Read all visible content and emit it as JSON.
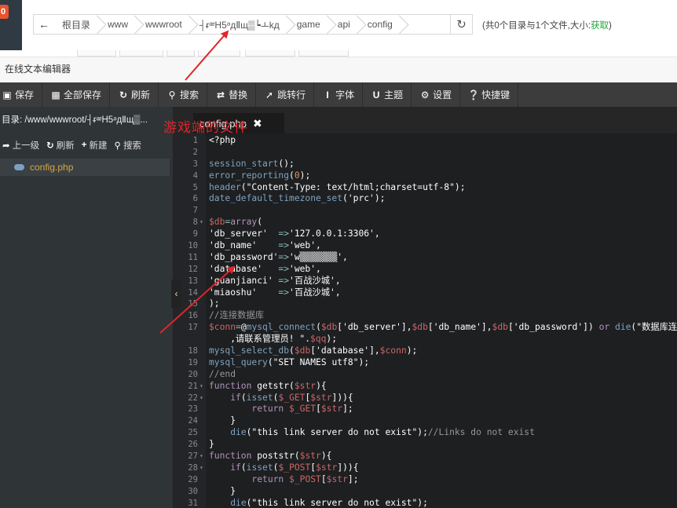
{
  "topbar": {
    "badge": "0",
    "back_icon": "arrow-left-icon",
    "breadcrumbs": [
      "根目录",
      "www",
      "wwwroot",
      "┤ᵲᵆH5ᵊдⅡщ▒┕ㅗkд",
      "game",
      "api",
      "config"
    ],
    "refresh_icon": "refresh-icon",
    "file_info": "(共0个目录与1个文件,大小:",
    "file_info_link": "获取",
    "file_info_end": ")"
  },
  "modal": {
    "title": "在线文本编辑器"
  },
  "toolbar": {
    "buttons": [
      {
        "label": "保存",
        "icon": "save-icon"
      },
      {
        "label": "全部保存",
        "icon": "save-all-icon"
      },
      {
        "label": "刷新",
        "icon": "refresh-icon"
      },
      {
        "label": "搜索",
        "icon": "search-icon"
      },
      {
        "label": "替换",
        "icon": "replace-icon"
      },
      {
        "label": "跳转行",
        "icon": "jump-icon"
      },
      {
        "label": "字体",
        "icon": "font-icon"
      },
      {
        "label": "主题",
        "icon": "theme-icon"
      },
      {
        "label": "设置",
        "icon": "gear-icon"
      },
      {
        "label": "快捷键",
        "icon": "help-icon"
      }
    ]
  },
  "sidebar": {
    "dir_label": "目录: /www/wwwroot/┤ᵲᵆH5ᵊдⅡщ▒...",
    "tools": [
      "上一级",
      "刷新",
      "新建",
      "搜索"
    ],
    "file": "config.php",
    "collapse_glyph": "‹"
  },
  "tab": {
    "label": "config.php",
    "close_glyph": "✖"
  },
  "annotation": {
    "text": "游戏端的文件"
  },
  "editor": {
    "lines": [
      {
        "n": "1",
        "fold": "",
        "segs": [
          [
            "<?php",
            "#ffffff"
          ]
        ]
      },
      {
        "n": "2",
        "fold": "",
        "segs": []
      },
      {
        "n": "3",
        "fold": "",
        "segs": [
          [
            "session_start",
            "#81a2be"
          ],
          [
            "();",
            "#ffffff"
          ]
        ]
      },
      {
        "n": "4",
        "fold": "",
        "segs": [
          [
            "error_reporting",
            "#81a2be"
          ],
          [
            "(",
            "#ffffff"
          ],
          [
            "0",
            "#de935f"
          ],
          [
            ");",
            "#ffffff"
          ]
        ]
      },
      {
        "n": "5",
        "fold": "",
        "segs": [
          [
            "header",
            "#81a2be"
          ],
          [
            "(",
            "#ffffff"
          ],
          [
            "\"Content-Type: text/html;charset=utf-8\"",
            "#ffffff"
          ],
          [
            ");",
            "#ffffff"
          ]
        ]
      },
      {
        "n": "6",
        "fold": "",
        "segs": [
          [
            "date_default_timezone_set",
            "#81a2be"
          ],
          [
            "('prc');",
            "#ffffff"
          ]
        ]
      },
      {
        "n": "7",
        "fold": "",
        "segs": []
      },
      {
        "n": "8",
        "fold": "▾",
        "segs": [
          [
            "$db",
            "#cc6666"
          ],
          [
            "=",
            "#8abeb7"
          ],
          [
            "array",
            "#b294bb"
          ],
          [
            "(",
            "#ffffff"
          ]
        ]
      },
      {
        "n": "9",
        "fold": "",
        "segs": [
          [
            "'db_server'  ",
            "#ffffff"
          ],
          [
            "=>",
            "#8abeb7"
          ],
          [
            "'127.0.0.1:3306',",
            "#ffffff"
          ]
        ]
      },
      {
        "n": "10",
        "fold": "",
        "segs": [
          [
            "'db_name'    ",
            "#ffffff"
          ],
          [
            "=>",
            "#8abeb7"
          ],
          [
            "'web',",
            "#ffffff"
          ]
        ]
      },
      {
        "n": "11",
        "fold": "",
        "segs": [
          [
            "'db_password'",
            "#ffffff"
          ],
          [
            "=>",
            "#8abeb7"
          ],
          [
            "'w▒▒▒▒▒▒▒',",
            "#ffffff"
          ]
        ]
      },
      {
        "n": "12",
        "fold": "",
        "segs": [
          [
            "'database'   ",
            "#ffffff"
          ],
          [
            "=>",
            "#8abeb7"
          ],
          [
            "'web',",
            "#ffffff"
          ]
        ]
      },
      {
        "n": "13",
        "fold": "",
        "segs": [
          [
            "'guanjianci' ",
            "#ffffff"
          ],
          [
            "=>",
            "#8abeb7"
          ],
          [
            "'百战沙城',",
            "#ffffff"
          ]
        ]
      },
      {
        "n": "14",
        "fold": "",
        "segs": [
          [
            "'miaoshu'    ",
            "#ffffff"
          ],
          [
            "=>",
            "#8abeb7"
          ],
          [
            "'百战沙城',",
            "#ffffff"
          ]
        ]
      },
      {
        "n": "15",
        "fold": "",
        "segs": [
          [
            ");",
            "#ffffff"
          ]
        ]
      },
      {
        "n": "16",
        "fold": "",
        "segs": [
          [
            "//连接数据库",
            "#969896"
          ]
        ]
      },
      {
        "n": "17",
        "fold": "",
        "segs": [
          [
            "$conn",
            "#cc6666"
          ],
          [
            "=",
            "#8abeb7"
          ],
          [
            "@",
            "#ffffff"
          ],
          [
            "mysql_connect",
            "#81a2be"
          ],
          [
            "(",
            "#ffffff"
          ],
          [
            "$db",
            "#cc6666"
          ],
          [
            "['db_server'],",
            "#ffffff"
          ],
          [
            "$db",
            "#cc6666"
          ],
          [
            "['db_name'],",
            "#ffffff"
          ],
          [
            "$db",
            "#cc6666"
          ],
          [
            "['db_password']) ",
            "#ffffff"
          ],
          [
            "or",
            "#b294bb"
          ],
          [
            " ",
            "#ffffff"
          ],
          [
            "die",
            "#81a2be"
          ],
          [
            "(\"数据库连",
            "#ffffff"
          ]
        ]
      },
      {
        "n": "",
        "fold": "",
        "segs": [
          [
            "    ,请联系管理员! \".",
            "#ffffff"
          ],
          [
            "$qq",
            "#cc6666"
          ],
          [
            ");",
            "#ffffff"
          ]
        ]
      },
      {
        "n": "18",
        "fold": "",
        "segs": [
          [
            "mysql_select_db",
            "#81a2be"
          ],
          [
            "(",
            "#ffffff"
          ],
          [
            "$db",
            "#cc6666"
          ],
          [
            "['database'],",
            "#ffffff"
          ],
          [
            "$conn",
            "#cc6666"
          ],
          [
            ");",
            "#ffffff"
          ]
        ]
      },
      {
        "n": "19",
        "fold": "",
        "segs": [
          [
            "mysql_query",
            "#81a2be"
          ],
          [
            "(\"SET NAMES utf8\");",
            "#ffffff"
          ]
        ]
      },
      {
        "n": "20",
        "fold": "",
        "segs": [
          [
            "//end",
            "#969896"
          ]
        ]
      },
      {
        "n": "21",
        "fold": "▾",
        "segs": [
          [
            "function",
            "#b294bb"
          ],
          [
            " ",
            "#ffffff"
          ],
          [
            "getstr",
            "#ffffff"
          ],
          [
            "(",
            "#ffffff"
          ],
          [
            "$str",
            "#cc6666"
          ],
          [
            "){",
            "#ffffff"
          ]
        ]
      },
      {
        "n": "22",
        "fold": "▾",
        "segs": [
          [
            "    ",
            "#ffffff"
          ],
          [
            "if",
            "#b294bb"
          ],
          [
            "(",
            "#ffffff"
          ],
          [
            "isset",
            "#81a2be"
          ],
          [
            "(",
            "#ffffff"
          ],
          [
            "$_GET",
            "#cc6666"
          ],
          [
            "[",
            "#ffffff"
          ],
          [
            "$str",
            "#cc6666"
          ],
          [
            "])){",
            "#ffffff"
          ]
        ]
      },
      {
        "n": "23",
        "fold": "",
        "segs": [
          [
            "        ",
            "#ffffff"
          ],
          [
            "return",
            "#b294bb"
          ],
          [
            " ",
            "#ffffff"
          ],
          [
            "$_GET",
            "#cc6666"
          ],
          [
            "[",
            "#ffffff"
          ],
          [
            "$str",
            "#cc6666"
          ],
          [
            "];",
            "#ffffff"
          ]
        ]
      },
      {
        "n": "24",
        "fold": "",
        "segs": [
          [
            "    }",
            "#ffffff"
          ]
        ]
      },
      {
        "n": "25",
        "fold": "",
        "segs": [
          [
            "    ",
            "#ffffff"
          ],
          [
            "die",
            "#81a2be"
          ],
          [
            "(\"this link server do not exist\");",
            "#ffffff"
          ],
          [
            "//Links do not exist",
            "#969896"
          ]
        ]
      },
      {
        "n": "26",
        "fold": "",
        "segs": [
          [
            "}",
            "#ffffff"
          ]
        ]
      },
      {
        "n": "27",
        "fold": "▾",
        "segs": [
          [
            "function",
            "#b294bb"
          ],
          [
            " ",
            "#ffffff"
          ],
          [
            "poststr",
            "#ffffff"
          ],
          [
            "(",
            "#ffffff"
          ],
          [
            "$str",
            "#cc6666"
          ],
          [
            "){",
            "#ffffff"
          ]
        ]
      },
      {
        "n": "28",
        "fold": "▾",
        "segs": [
          [
            "    ",
            "#ffffff"
          ],
          [
            "if",
            "#b294bb"
          ],
          [
            "(",
            "#ffffff"
          ],
          [
            "isset",
            "#81a2be"
          ],
          [
            "(",
            "#ffffff"
          ],
          [
            "$_POST",
            "#cc6666"
          ],
          [
            "[",
            "#ffffff"
          ],
          [
            "$str",
            "#cc6666"
          ],
          [
            "])){",
            "#ffffff"
          ]
        ]
      },
      {
        "n": "29",
        "fold": "",
        "segs": [
          [
            "        ",
            "#ffffff"
          ],
          [
            "return",
            "#b294bb"
          ],
          [
            " ",
            "#ffffff"
          ],
          [
            "$_POST",
            "#cc6666"
          ],
          [
            "[",
            "#ffffff"
          ],
          [
            "$str",
            "#cc6666"
          ],
          [
            "];",
            "#ffffff"
          ]
        ]
      },
      {
        "n": "30",
        "fold": "",
        "segs": [
          [
            "    }",
            "#ffffff"
          ]
        ]
      },
      {
        "n": "31",
        "fold": "",
        "segs": [
          [
            "    ",
            "#ffffff"
          ],
          [
            "die",
            "#81a2be"
          ],
          [
            "(\"this link server do not exist\");",
            "#ffffff"
          ]
        ]
      }
    ]
  }
}
